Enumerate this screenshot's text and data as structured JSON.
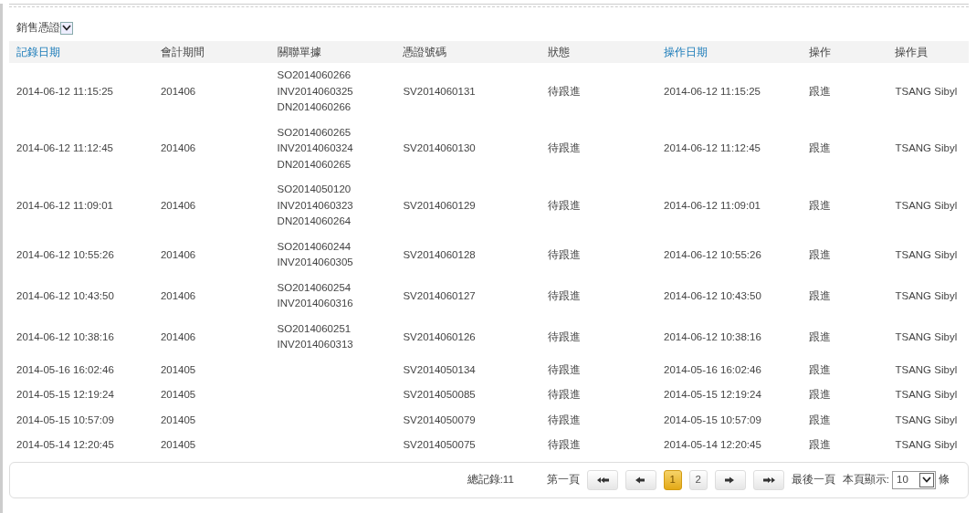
{
  "voucher_type": {
    "value": "銷售憑證"
  },
  "table": {
    "columns": [
      {
        "label": "記錄日期",
        "sortable": true
      },
      {
        "label": "會計期間",
        "sortable": false
      },
      {
        "label": "關聯單據",
        "sortable": false
      },
      {
        "label": "憑證號碼",
        "sortable": false
      },
      {
        "label": "狀態",
        "sortable": false
      },
      {
        "label": "操作日期",
        "sortable": true
      },
      {
        "label": "操作",
        "sortable": false
      },
      {
        "label": "操作員",
        "sortable": false
      }
    ],
    "rows": [
      {
        "record_date": "2014-06-12 11:15:25",
        "period": "201406",
        "related": [
          "SO2014060266",
          "INV2014060325",
          "DN2014060266"
        ],
        "voucher_no": "SV2014060131",
        "status": "待跟進",
        "op_date": "2014-06-12 11:15:25",
        "action": "跟進",
        "operator": "TSANG Sibyl"
      },
      {
        "record_date": "2014-06-12 11:12:45",
        "period": "201406",
        "related": [
          "SO2014060265",
          "INV2014060324",
          "DN2014060265"
        ],
        "voucher_no": "SV2014060130",
        "status": "待跟進",
        "op_date": "2014-06-12 11:12:45",
        "action": "跟進",
        "operator": "TSANG Sibyl"
      },
      {
        "record_date": "2014-06-12 11:09:01",
        "period": "201406",
        "related": [
          "SO2014050120",
          "INV2014060323",
          "DN2014060264"
        ],
        "voucher_no": "SV2014060129",
        "status": "待跟進",
        "op_date": "2014-06-12 11:09:01",
        "action": "跟進",
        "operator": "TSANG Sibyl"
      },
      {
        "record_date": "2014-06-12 10:55:26",
        "period": "201406",
        "related": [
          "SO2014060244",
          "INV2014060305"
        ],
        "voucher_no": "SV2014060128",
        "status": "待跟進",
        "op_date": "2014-06-12 10:55:26",
        "action": "跟進",
        "operator": "TSANG Sibyl"
      },
      {
        "record_date": "2014-06-12 10:43:50",
        "period": "201406",
        "related": [
          "SO2014060254",
          "INV2014060316"
        ],
        "voucher_no": "SV2014060127",
        "status": "待跟進",
        "op_date": "2014-06-12 10:43:50",
        "action": "跟進",
        "operator": "TSANG Sibyl"
      },
      {
        "record_date": "2014-06-12 10:38:16",
        "period": "201406",
        "related": [
          "SO2014060251",
          "INV2014060313"
        ],
        "voucher_no": "SV2014060126",
        "status": "待跟進",
        "op_date": "2014-06-12 10:38:16",
        "action": "跟進",
        "operator": "TSANG Sibyl"
      },
      {
        "record_date": "2014-05-16 16:02:46",
        "period": "201405",
        "voucher_no": "SV2014050134",
        "status": "待跟進",
        "op_date": "2014-05-16 16:02:46",
        "action": "跟進",
        "operator": "TSANG Sibyl"
      },
      {
        "record_date": "2014-05-15 12:19:24",
        "period": "201405",
        "voucher_no": "SV2014050085",
        "status": "待跟進",
        "op_date": "2014-05-15 12:19:24",
        "action": "跟進",
        "operator": "TSANG Sibyl"
      },
      {
        "record_date": "2014-05-15 10:57:09",
        "period": "201405",
        "voucher_no": "SV2014050079",
        "status": "待跟進",
        "op_date": "2014-05-15 10:57:09",
        "action": "跟進",
        "operator": "TSANG Sibyl"
      },
      {
        "record_date": "2014-05-14 12:20:45",
        "period": "201405",
        "voucher_no": "SV2014050075",
        "status": "待跟進",
        "op_date": "2014-05-14 12:20:45",
        "action": "跟進",
        "operator": "TSANG Sibyl"
      }
    ]
  },
  "pager": {
    "total": "總記錄:11",
    "first_label": "第一頁",
    "pages": [
      {
        "label": "1",
        "selected": true
      },
      {
        "label": "2",
        "selected": false
      }
    ],
    "last_label": "最後一頁",
    "page_size_label": "本頁顯示:",
    "page_size": "10",
    "unit": "條"
  }
}
